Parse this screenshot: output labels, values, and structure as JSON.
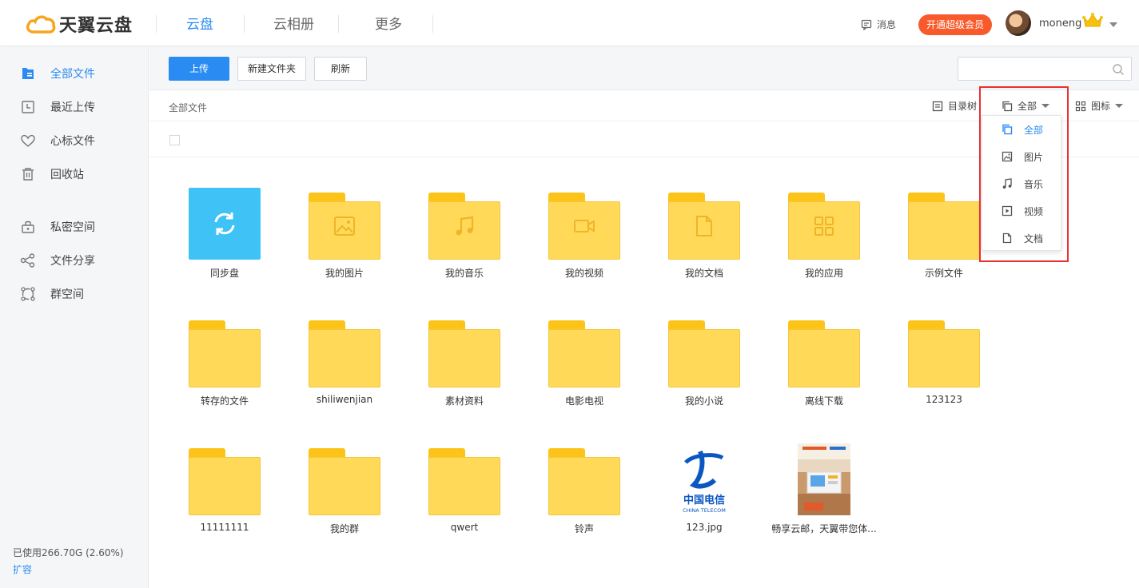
{
  "header": {
    "logo_text": "天翼云盘",
    "nav": [
      "云盘",
      "云相册",
      "更多"
    ],
    "message_label": "消息",
    "vip_button": "开通超级会员",
    "username": "moneng"
  },
  "sidebar": {
    "items": [
      {
        "label": "全部文件",
        "icon": "file-list-icon",
        "active": true
      },
      {
        "label": "最近上传",
        "icon": "clock-icon"
      },
      {
        "label": "心标文件",
        "icon": "heart-icon"
      },
      {
        "label": "回收站",
        "icon": "trash-icon"
      },
      {
        "label": "私密空间",
        "icon": "lock-box-icon"
      },
      {
        "label": "文件分享",
        "icon": "share-icon"
      },
      {
        "label": "群空间",
        "icon": "group-icon"
      }
    ],
    "usage_text": "已使用266.70G (2.60%)",
    "expand_label": "扩容"
  },
  "toolbar": {
    "upload_label": "上传",
    "new_folder_label": "新建文件夹",
    "refresh_label": "刷新",
    "search_placeholder": ""
  },
  "breadcrumb": {
    "current": "全部文件"
  },
  "view_controls": {
    "tree_label": "目录树",
    "filter_label": "全部",
    "icon_view_label": "图标"
  },
  "filter_dropdown": {
    "items": [
      {
        "label": "全部",
        "icon": "copy-icon",
        "active": true
      },
      {
        "label": "图片",
        "icon": "image-icon"
      },
      {
        "label": "音乐",
        "icon": "music-icon"
      },
      {
        "label": "视频",
        "icon": "video-icon"
      },
      {
        "label": "文档",
        "icon": "document-icon"
      }
    ]
  },
  "files": [
    {
      "name": "同步盘",
      "kind": "sync"
    },
    {
      "name": "我的图片",
      "kind": "folder",
      "glyph": "image"
    },
    {
      "name": "我的音乐",
      "kind": "folder",
      "glyph": "music"
    },
    {
      "name": "我的视频",
      "kind": "folder",
      "glyph": "video"
    },
    {
      "name": "我的文档",
      "kind": "folder",
      "glyph": "doc"
    },
    {
      "name": "我的应用",
      "kind": "folder",
      "glyph": "apps"
    },
    {
      "name": "示例文件",
      "kind": "folder"
    },
    {
      "name": "转存的文件",
      "kind": "folder"
    },
    {
      "name": "shiliwenjian",
      "kind": "folder"
    },
    {
      "name": "素材资料",
      "kind": "folder"
    },
    {
      "name": "电影电视",
      "kind": "folder"
    },
    {
      "name": "我的小说",
      "kind": "folder"
    },
    {
      "name": "离线下载",
      "kind": "folder"
    },
    {
      "name": "123123",
      "kind": "folder"
    },
    {
      "name": "11111111",
      "kind": "folder"
    },
    {
      "name": "我的群",
      "kind": "folder"
    },
    {
      "name": "qwert",
      "kind": "folder"
    },
    {
      "name": "铃声",
      "kind": "folder"
    },
    {
      "name": "123.jpg",
      "kind": "telecom"
    },
    {
      "name": "畅享云邮，天翼带您体...",
      "kind": "promo"
    }
  ],
  "telecom_logo": {
    "cn": "中国电信",
    "en": "CHINA TELECOM"
  },
  "colors": {
    "accent": "#2a8bf2",
    "folder": "#ffd957",
    "vip": "#f85a2c",
    "highlight": "#e8312f"
  }
}
